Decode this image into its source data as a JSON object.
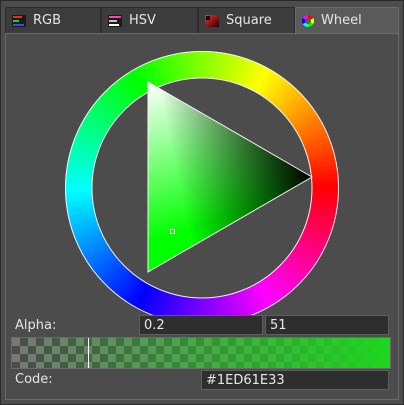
{
  "tabs": [
    {
      "label": "RGB",
      "icon": "rgb-icon",
      "active": false
    },
    {
      "label": "HSV",
      "icon": "hsv-icon",
      "active": false
    },
    {
      "label": "Square",
      "icon": "square-icon",
      "active": false
    },
    {
      "label": "Wheel",
      "icon": "wheel-icon",
      "active": true
    }
  ],
  "alpha": {
    "label": "Alpha:",
    "fraction": "0.2",
    "value": "51",
    "level": 0.2
  },
  "code": {
    "label": "Code:",
    "value": "#1ED61E33"
  },
  "colors": {
    "selected": "#1ED61E",
    "hue": "#00FF00"
  }
}
